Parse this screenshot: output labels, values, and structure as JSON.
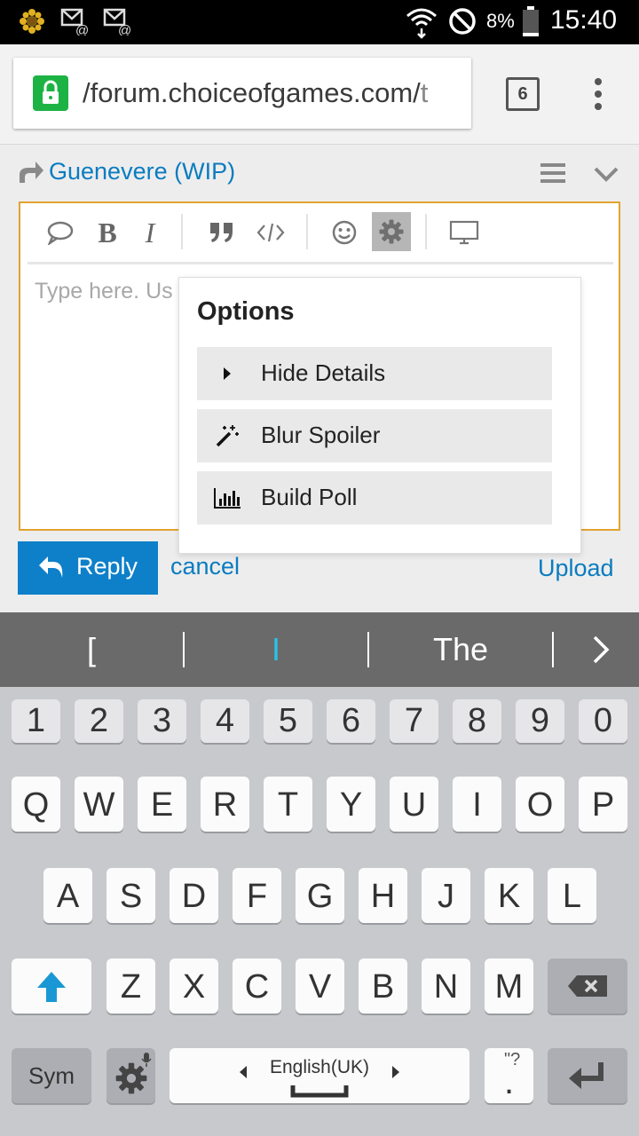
{
  "status_bar": {
    "time": "15:40",
    "battery": "8%"
  },
  "browser": {
    "url_main": "/forum.choiceofgames.com/",
    "url_tail": "t",
    "tab_count": "6"
  },
  "page": {
    "topic_title": "Guenevere (WIP)",
    "placeholder": "Type here. Us format. Drag",
    "options_popup": {
      "title": "Options",
      "items": [
        {
          "label": "Hide Details",
          "icon": "caret-right-icon"
        },
        {
          "label": "Blur Spoiler",
          "icon": "magic-wand-icon"
        },
        {
          "label": "Build Poll",
          "icon": "bar-chart-icon"
        }
      ]
    },
    "reply_label": "Reply",
    "cancel_label": "cancel",
    "upload_label": "Upload"
  },
  "suggestions": [
    "[",
    "I",
    "The"
  ],
  "keyboard": {
    "numbers": [
      "1",
      "2",
      "3",
      "4",
      "5",
      "6",
      "7",
      "8",
      "9",
      "0"
    ],
    "row1": [
      "Q",
      "W",
      "E",
      "R",
      "T",
      "Y",
      "U",
      "I",
      "O",
      "P"
    ],
    "row2": [
      "A",
      "S",
      "D",
      "F",
      "G",
      "H",
      "J",
      "K",
      "L"
    ],
    "row3": [
      "Z",
      "X",
      "C",
      "V",
      "B",
      "N",
      "M"
    ],
    "sym_label": "Sym",
    "space_label": "English(UK)",
    "dot_hint": "\"?"
  },
  "colors": {
    "link": "#0a7cc0",
    "reply_button": "#0e80c9",
    "editor_border": "#e3a330",
    "lock": "#1db344"
  }
}
